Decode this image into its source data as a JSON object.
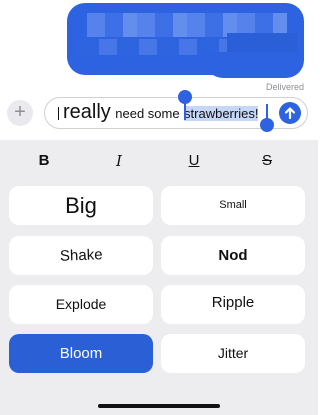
{
  "message": {
    "status": "Delivered",
    "composer": {
      "word_big": "really",
      "word_plain": "need some",
      "selected": "strawberries!"
    }
  },
  "format_bar": {
    "bold": "B",
    "italic": "I",
    "underline": "U",
    "strike": "S"
  },
  "effects": [
    {
      "label": "Big"
    },
    {
      "label": "Small"
    },
    {
      "label": "Shake"
    },
    {
      "label": "Nod"
    },
    {
      "label": "Explode"
    },
    {
      "label": "Ripple"
    },
    {
      "label": "Bloom",
      "selected": true
    },
    {
      "label": "Jitter"
    }
  ],
  "icons": {
    "add": "plus-icon",
    "send": "arrow-up-icon"
  },
  "colors": {
    "accent": "#2d63e0",
    "panel_bg": "#ededf0",
    "selection": "#c6d6f7"
  }
}
